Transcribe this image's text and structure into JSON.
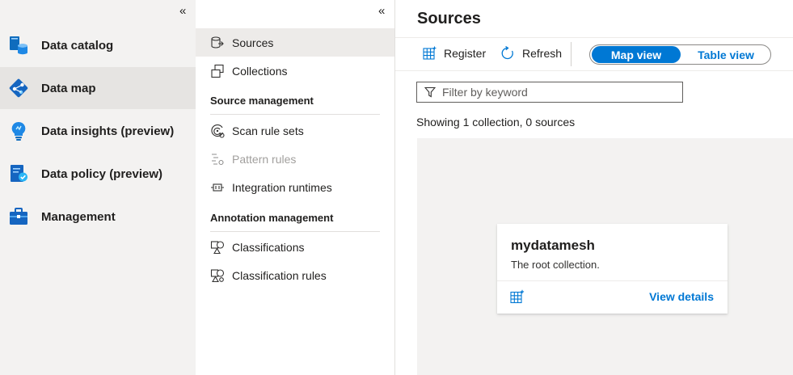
{
  "leftnav": {
    "collapse_glyph": "«",
    "items": [
      {
        "label": "Data catalog",
        "icon": "data-catalog-icon"
      },
      {
        "label": "Data map",
        "icon": "data-map-icon",
        "active": true
      },
      {
        "label": "Data insights (preview)",
        "icon": "data-insights-icon"
      },
      {
        "label": "Data policy (preview)",
        "icon": "data-policy-icon"
      },
      {
        "label": "Management",
        "icon": "management-toolbox-icon"
      }
    ]
  },
  "subnav": {
    "collapse_glyph": "«",
    "items": [
      {
        "label": "Sources",
        "icon": "sources-icon",
        "active": true
      },
      {
        "label": "Collections",
        "icon": "collections-icon"
      }
    ],
    "source_management": {
      "heading": "Source management",
      "items": [
        {
          "label": "Scan rule sets",
          "icon": "scan-rule-sets-icon"
        },
        {
          "label": "Pattern rules",
          "icon": "pattern-rules-icon",
          "disabled": true
        },
        {
          "label": "Integration runtimes",
          "icon": "integration-runtimes-icon"
        }
      ]
    },
    "annotation_management": {
      "heading": "Annotation management",
      "items": [
        {
          "label": "Classifications",
          "icon": "classifications-icon"
        },
        {
          "label": "Classification rules",
          "icon": "classification-rules-icon"
        }
      ]
    }
  },
  "main": {
    "title": "Sources",
    "toolbar": {
      "register_label": "Register",
      "refresh_label": "Refresh",
      "view_toggle": {
        "selected": "Map view",
        "other": "Table view"
      }
    },
    "filter": {
      "placeholder": "Filter by keyword",
      "value": ""
    },
    "summary": "Showing 1 collection, 0 sources",
    "collection_card": {
      "name": "mydatamesh",
      "description": "The root collection.",
      "link": "View details"
    }
  },
  "colors": {
    "accent": "#0078d4",
    "leftnav_bg": "#f3f2f1",
    "active_bg": "#e6e4e2",
    "canvas_bg": "#f3f2f1"
  }
}
